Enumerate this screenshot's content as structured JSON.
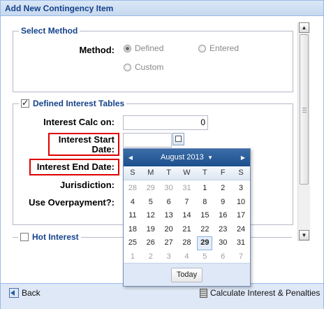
{
  "window": {
    "title": "Add New Contingency Item"
  },
  "select_method": {
    "legend": "Select Method",
    "method_label": "Method:",
    "options": [
      {
        "label": "Defined",
        "checked": true
      },
      {
        "label": "Entered",
        "checked": false
      },
      {
        "label": "Custom",
        "checked": false
      }
    ]
  },
  "defined_interest": {
    "legend": "Defined Interest Tables",
    "checked": true,
    "interest_calc_label": "Interest Calc on:",
    "interest_calc_value": "0",
    "interest_start_label_1": "Interest Start",
    "interest_start_label_2": "Date:",
    "interest_end_label": "Interest End Date:",
    "jurisdiction_label": "Jurisdiction:",
    "use_overpayment_label": "Use Overpayment?:"
  },
  "hot_interest": {
    "legend": "Hot Interest",
    "checked": false
  },
  "date_picker": {
    "month_label": "August 2013",
    "weekdays": [
      "S",
      "M",
      "T",
      "W",
      "T",
      "F",
      "S"
    ],
    "days": [
      {
        "d": "28",
        "o": true
      },
      {
        "d": "29",
        "o": true
      },
      {
        "d": "30",
        "o": true
      },
      {
        "d": "31",
        "o": true
      },
      {
        "d": "1"
      },
      {
        "d": "2"
      },
      {
        "d": "3"
      },
      {
        "d": "4"
      },
      {
        "d": "5"
      },
      {
        "d": "6"
      },
      {
        "d": "7"
      },
      {
        "d": "8"
      },
      {
        "d": "9"
      },
      {
        "d": "10"
      },
      {
        "d": "11"
      },
      {
        "d": "12"
      },
      {
        "d": "13"
      },
      {
        "d": "14"
      },
      {
        "d": "15"
      },
      {
        "d": "16"
      },
      {
        "d": "17"
      },
      {
        "d": "18"
      },
      {
        "d": "19"
      },
      {
        "d": "20"
      },
      {
        "d": "21"
      },
      {
        "d": "22"
      },
      {
        "d": "23"
      },
      {
        "d": "24"
      },
      {
        "d": "25"
      },
      {
        "d": "26"
      },
      {
        "d": "27"
      },
      {
        "d": "28"
      },
      {
        "d": "29",
        "s": true
      },
      {
        "d": "30"
      },
      {
        "d": "31"
      },
      {
        "d": "1",
        "o": true
      },
      {
        "d": "2",
        "o": true
      },
      {
        "d": "3",
        "o": true
      },
      {
        "d": "4",
        "o": true
      },
      {
        "d": "5",
        "o": true
      },
      {
        "d": "6",
        "o": true
      },
      {
        "d": "7",
        "o": true
      }
    ],
    "today_label": "Today"
  },
  "footer": {
    "back_label": "Back",
    "calculate_label": "Calculate Interest & Penalties"
  },
  "colors": {
    "title": "#15428b",
    "highlight": "#e00000",
    "picker_header": "#1c4f8c"
  }
}
